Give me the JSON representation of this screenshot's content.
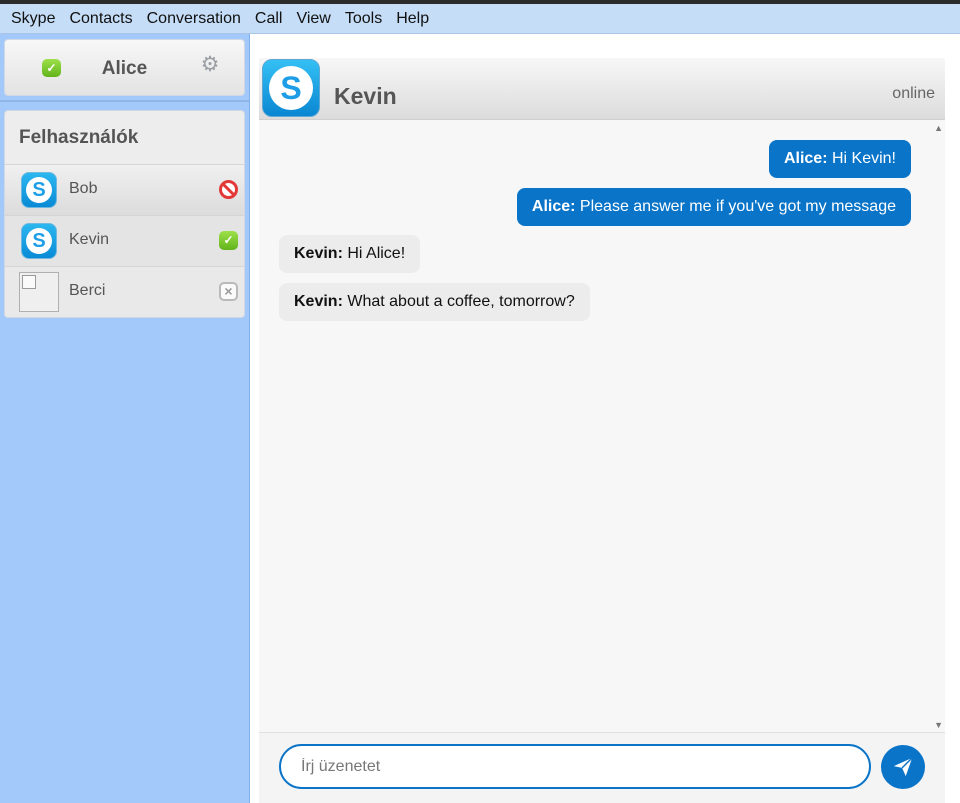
{
  "menu": {
    "items": [
      {
        "label": "Skype"
      },
      {
        "label": "Contacts"
      },
      {
        "label": "Conversation"
      },
      {
        "label": "Call"
      },
      {
        "label": "View"
      },
      {
        "label": "Tools"
      },
      {
        "label": "Help"
      }
    ]
  },
  "profile": {
    "name": "Alice",
    "status_icon": "online-check-icon",
    "settings_icon": "gear-icon"
  },
  "users": {
    "title": "Felhasználók",
    "list": [
      {
        "name": "Bob",
        "status": "blocked",
        "avatar": "skype-logo"
      },
      {
        "name": "Kevin",
        "status": "online",
        "avatar": "skype-logo"
      },
      {
        "name": "Berci",
        "status": "offline",
        "avatar": "broken-image"
      }
    ]
  },
  "conversation": {
    "contact_name": "Kevin",
    "contact_status": "online",
    "messages": [
      {
        "sender": "Alice:",
        "text": " Hi Kevin!",
        "direction": "outgoing"
      },
      {
        "sender": "Alice:",
        "text": " Please answer me if you've got my message",
        "direction": "outgoing"
      },
      {
        "sender": "Kevin:",
        "text": " Hi Alice!",
        "direction": "incoming"
      },
      {
        "sender": "Kevin:",
        "text": " What about a coffee, tomorrow?",
        "direction": "incoming"
      }
    ]
  },
  "composer": {
    "placeholder": "Írj üzenetet",
    "value": "",
    "send_icon": "paper-plane-icon"
  },
  "colors": {
    "sidebar_bg": "#a3c9fb",
    "menubar_bg": "#c5ddf7",
    "accent": "#0a74c8",
    "online_green": "#62b41c",
    "blocked_red": "#e33838"
  }
}
